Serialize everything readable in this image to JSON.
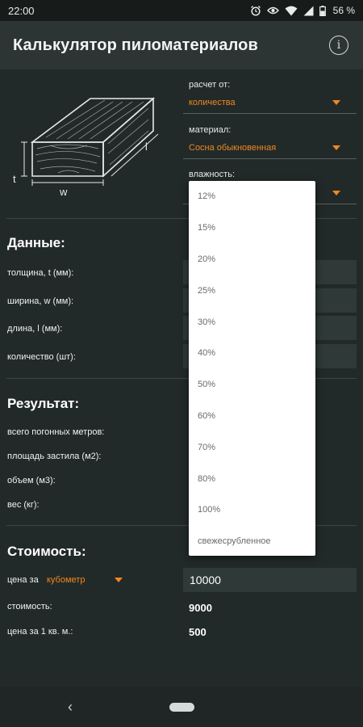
{
  "status_bar": {
    "time": "22:00",
    "battery": "56 %",
    "icons": [
      "alarm-icon",
      "eye-icon",
      "wifi-icon",
      "signal-icon",
      "battery-icon"
    ]
  },
  "app_bar": {
    "title": "Калькулятор пиломатериалов",
    "info_icon": "info-icon"
  },
  "diagram": {
    "t_label": "t",
    "w_label": "w",
    "l_label": "l"
  },
  "selectors": {
    "calc_from": {
      "label": "расчет от:",
      "value": "количества"
    },
    "material": {
      "label": "материал:",
      "value": "Сосна обыкновенная"
    },
    "moisture": {
      "label": "влажность:"
    }
  },
  "moisture_options": [
    "12%",
    "15%",
    "20%",
    "25%",
    "30%",
    "40%",
    "50%",
    "60%",
    "70%",
    "80%",
    "100%",
    "свежесрубленное"
  ],
  "data_section": {
    "title": "Данные:",
    "rows": [
      {
        "label": "толщина, t (мм):"
      },
      {
        "label": "ширина, w (мм):"
      },
      {
        "label": "длина, l (мм):"
      },
      {
        "label": "количество (шт):"
      }
    ]
  },
  "result_section": {
    "title": "Результат:",
    "rows": [
      {
        "label": "всего погонных метров:"
      },
      {
        "label": "площадь застила (м2):"
      },
      {
        "label": "объем (м3):"
      },
      {
        "label": "вес (кг):"
      }
    ]
  },
  "cost_section": {
    "title": "Стоимость:",
    "price_label": "цена за",
    "price_unit": "кубометр",
    "price_value": "10000",
    "cost_label": "стоимость:",
    "cost_value": "9000",
    "per_sqm_label": "цена за 1 кв. м.:",
    "per_sqm_value": "500"
  },
  "nav_bar": {
    "back_icon": "back-icon",
    "home_icon": "home-pill-icon",
    "back_glyph": "‹"
  },
  "colors": {
    "background": "#222a29",
    "app_bar": "#2c3534",
    "accent": "#f0881f",
    "input_bg": "#2f3938",
    "dropdown_bg": "#ffffff"
  }
}
